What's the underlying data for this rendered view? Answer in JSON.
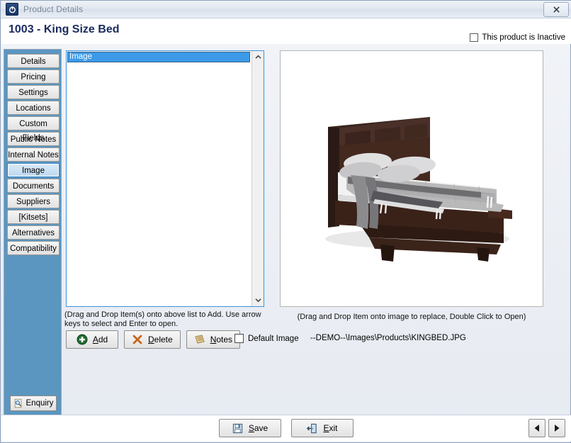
{
  "window": {
    "title": "Product Details",
    "app_icon": "power-icon",
    "close_label": "✕"
  },
  "header": {
    "product_title": "1003 - King Size Bed",
    "inactive_label": "This product is Inactive",
    "inactive_checked": false
  },
  "sidebar": {
    "items": [
      {
        "label": "Details",
        "selected": false
      },
      {
        "label": "Pricing",
        "selected": false
      },
      {
        "label": "Settings",
        "selected": false
      },
      {
        "label": "Locations",
        "selected": false
      },
      {
        "label": "Custom Fields",
        "selected": false
      },
      {
        "label": "Public Notes",
        "selected": false
      },
      {
        "label": "Internal Notes",
        "selected": false
      },
      {
        "label": "Image",
        "selected": true
      },
      {
        "label": "Documents",
        "selected": false
      },
      {
        "label": "Suppliers",
        "selected": false
      },
      {
        "label": "[Kitsets]",
        "selected": false
      },
      {
        "label": "Alternatives",
        "selected": false
      },
      {
        "label": "Compatibility",
        "selected": false
      }
    ],
    "enquiry_label": "Enquiry",
    "enquiry_icon": "magnifier-page-icon"
  },
  "list_panel": {
    "rows": [
      {
        "label": "Image",
        "selected": true
      }
    ],
    "scroll_up_icon": "chevron-up-icon",
    "scroll_down_icon": "chevron-down-icon",
    "hint": "(Drag and Drop Item(s) onto above list to Add. Use arrow keys to select and Enter to open.",
    "buttons": [
      {
        "label": "Add",
        "accel": "A",
        "icon": "plus-circle-icon"
      },
      {
        "label": "Delete",
        "accel": "D",
        "icon": "x-mark-icon"
      },
      {
        "label": "Notes",
        "accel": "N",
        "icon": "notepad-icon"
      }
    ],
    "default_image_label": "Default Image",
    "default_image_checked": false
  },
  "image_panel": {
    "alt": "king size bed product photo",
    "hint": "(Drag and Drop Item onto image to replace, Double Click to Open)",
    "file_path": "--DEMO--\\Images\\Products\\KINGBED.JPG"
  },
  "footer": {
    "save_label": "Save",
    "save_accel": "S",
    "save_icon": "floppy-disk-icon",
    "exit_label": "Exit",
    "exit_accel": "E",
    "exit_icon": "exit-door-icon",
    "prev_icon": "triangle-left-icon",
    "next_icon": "triangle-right-icon"
  },
  "colors": {
    "accent_blue": "#3c9ae8",
    "rail_blue": "#5b96c0",
    "title_navy": "#1a2a5e",
    "add_green": "#1f6b2e",
    "delete_orange": "#c8641a",
    "notes_gold": "#d9b879"
  }
}
